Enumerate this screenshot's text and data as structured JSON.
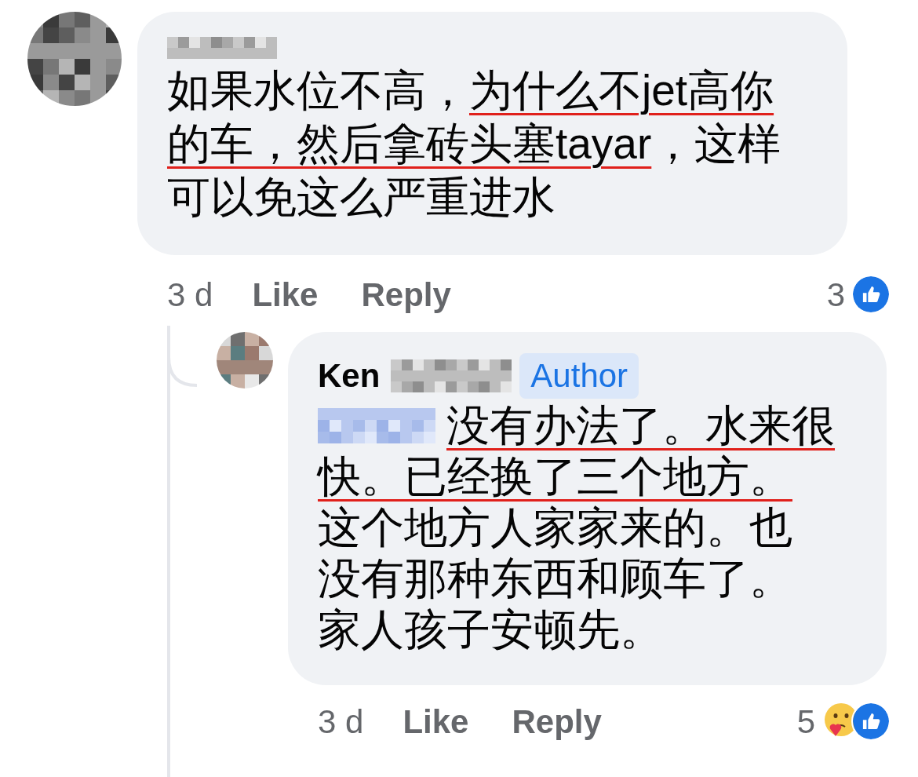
{
  "comment": {
    "body": [
      {
        "text": "如果水位不高，",
        "underlined": false
      },
      {
        "text": "为什么不jet高你的车，然后拿砖头塞tayar",
        "underlined": true
      },
      {
        "text": "，这样可以免这么严重进水",
        "underlined": false
      }
    ],
    "time": "3 d",
    "like": "Like",
    "reply": "Reply",
    "reaction_count": "3",
    "reactions": [
      {
        "kind": "like"
      }
    ]
  },
  "reply": {
    "name": "Ken",
    "badge": "Author",
    "first_line": [
      {
        "text": "没有办法了。水来很",
        "underlined": true
      }
    ],
    "body": [
      {
        "text": "快。已经换了三个地方。",
        "underlined": true
      },
      {
        "text": "这个地方人家家来的。也没有那种东西和顾车了。家人孩子安顿先。",
        "underlined": false
      }
    ],
    "time": "3 d",
    "like": "Like",
    "reply": "Reply",
    "reaction_count": "5",
    "reactions": [
      {
        "kind": "care"
      },
      {
        "kind": "like"
      }
    ]
  }
}
